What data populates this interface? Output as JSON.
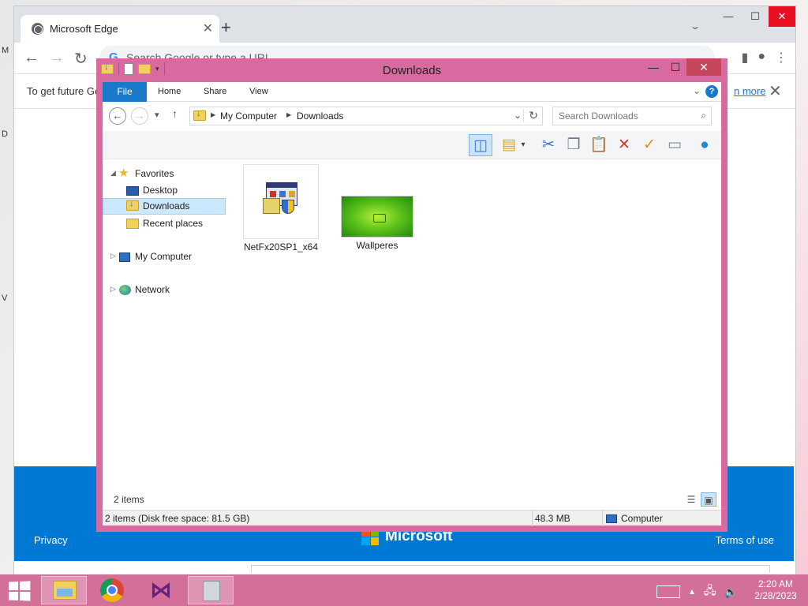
{
  "desktop": {
    "edge_letters": [
      "M",
      "D",
      "V"
    ]
  },
  "browser": {
    "tab_title": "Microsoft Edge",
    "omnibox_placeholder": "Search Google or type a URL",
    "infobar_message": "To get future Ge",
    "infobar_link": "n more",
    "footer_privacy": "Privacy",
    "footer_brand": "Microsoft",
    "footer_terms": "Terms of use"
  },
  "explorer": {
    "title": "Downloads",
    "ribbon_tabs": {
      "file": "File",
      "home": "Home",
      "share": "Share",
      "view": "View"
    },
    "breadcrumb": [
      "My Computer",
      "Downloads"
    ],
    "search_placeholder": "Search Downloads",
    "nav": {
      "favorites": "Favorites",
      "desktop": "Desktop",
      "downloads": "Downloads",
      "recent": "Recent places",
      "my_computer": "My Computer",
      "network": "Network"
    },
    "files": [
      {
        "name": "NetFx20SP1_x64",
        "type": "installer"
      },
      {
        "name": "Wallperes",
        "type": "image"
      }
    ],
    "item_count": "2 items",
    "status": {
      "summary": "2 items (Disk free space: 81.5 GB)",
      "size": "48.3 MB",
      "location": "Computer"
    }
  },
  "taskbar": {
    "apps": [
      "file-explorer",
      "chrome",
      "visual-studio",
      "recycle-bin"
    ],
    "time": "2:20 AM",
    "date": "2/28/2023"
  },
  "colors": {
    "accent_blue": "#0078d4",
    "explorer_frame": "#d96aa0",
    "taskbar": "#d3709a",
    "file_tab": "#1979ca"
  }
}
